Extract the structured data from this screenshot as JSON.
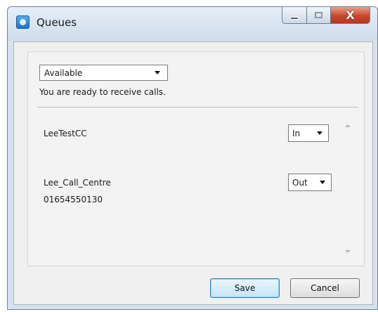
{
  "window": {
    "title": "Queues",
    "close_glyph": "X"
  },
  "status": {
    "selected": "Available",
    "message": "You are ready to receive calls."
  },
  "queues": [
    {
      "name": "LeeTestCC",
      "number": "",
      "state": "In"
    },
    {
      "name": "Lee_Call_Centre",
      "number": "01654550130",
      "state": "Out"
    }
  ],
  "buttons": {
    "save": "Save",
    "cancel": "Cancel"
  },
  "icons": {
    "app": "queues-app-icon",
    "minimize": "minimize-icon",
    "maximize": "maximize-icon",
    "close": "close-icon",
    "dropdown": "chevron-down-icon",
    "scroll_up": "scroll-up-icon",
    "scroll_down": "scroll-down-icon"
  },
  "colors": {
    "close_button": "#c9462d",
    "default_button_border": "#3c7fb1",
    "titlebar": "#d6e2ee"
  }
}
